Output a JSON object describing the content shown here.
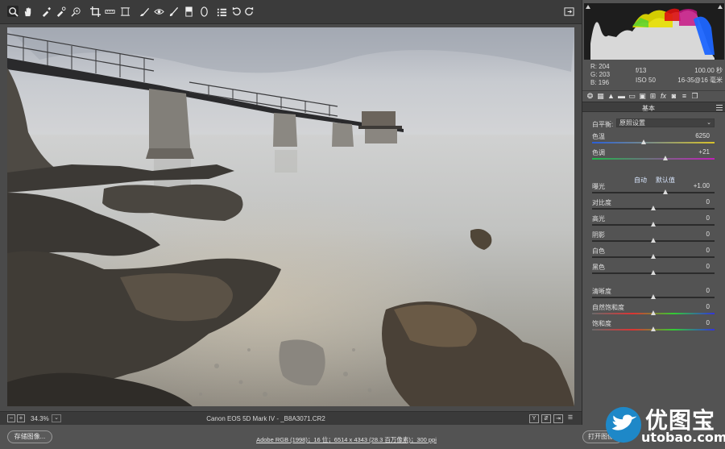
{
  "toolbar": {
    "tools": [
      {
        "name": "zoom-tool",
        "icon": "magnifier-icon"
      },
      {
        "name": "hand-tool",
        "icon": "hand-icon"
      },
      {
        "name": "white-balance-tool",
        "icon": "eyedropper-icon"
      },
      {
        "name": "color-sampler-tool",
        "icon": "color-sampler-icon"
      },
      {
        "name": "targeted-adjustment-tool",
        "icon": "target-icon"
      },
      {
        "name": "crop-tool",
        "icon": "crop-icon"
      },
      {
        "name": "straighten-tool",
        "icon": "ruler-icon"
      },
      {
        "name": "transform-tool",
        "icon": "transform-icon"
      },
      {
        "name": "spot-removal-tool",
        "icon": "brush-heal-icon"
      },
      {
        "name": "red-eye-tool",
        "icon": "red-eye-icon"
      },
      {
        "name": "adjustment-brush-tool",
        "icon": "brush-icon"
      },
      {
        "name": "graduated-filter-tool",
        "icon": "gradient-icon"
      },
      {
        "name": "radial-filter-tool",
        "icon": "ellipse-icon"
      },
      {
        "name": "preferences-button",
        "icon": "list-icon"
      },
      {
        "name": "rotate-left-button",
        "icon": "rotate-ccw-icon"
      },
      {
        "name": "rotate-right-button",
        "icon": "rotate-cw-icon"
      }
    ]
  },
  "readout": {
    "r": "R: 204",
    "g": "G: 203",
    "b": "B: 196",
    "aperture": "f/13",
    "shutter": "100.00 秒",
    "iso": "ISO 50",
    "lens": "16-35@16 毫米"
  },
  "panel": {
    "section_title": "基本",
    "wb_label": "白平衡:",
    "wb_value": "原照设置",
    "auto_label": "自动",
    "default_label": "默认值",
    "sliders": [
      {
        "id": "temperature",
        "label": "色温",
        "value": "6250",
        "pos": 0.42
      },
      {
        "id": "tint",
        "label": "色调",
        "value": "+21",
        "pos": 0.6
      },
      {
        "id": "exposure",
        "label": "曝光",
        "value": "+1.00",
        "pos": 0.6
      },
      {
        "id": "contrast",
        "label": "对比度",
        "value": "0",
        "pos": 0.5
      },
      {
        "id": "highlights",
        "label": "高光",
        "value": "0",
        "pos": 0.5
      },
      {
        "id": "shadows",
        "label": "阴影",
        "value": "0",
        "pos": 0.5
      },
      {
        "id": "whites",
        "label": "白色",
        "value": "0",
        "pos": 0.5
      },
      {
        "id": "blacks",
        "label": "黑色",
        "value": "0",
        "pos": 0.5
      },
      {
        "id": "clarity",
        "label": "清晰度",
        "value": "0",
        "pos": 0.5
      },
      {
        "id": "vibrance",
        "label": "自然饱和度",
        "value": "0",
        "pos": 0.5
      },
      {
        "id": "saturation",
        "label": "饱和度",
        "value": "0",
        "pos": 0.5
      }
    ]
  },
  "status": {
    "zoom": "34.3%",
    "file": "Canon EOS 5D Mark IV - _B8A3071.CR2",
    "view_y": "Y"
  },
  "bottom": {
    "save_label": "存储图像...",
    "workflow_link": "Adobe RGB (1998)；16 位；6514 x 4343 (28.3 百万像素)；300 ppi",
    "open_label": "打开图像"
  },
  "watermark": {
    "title": "优图宝",
    "url": "utobao.com"
  },
  "colors": {
    "panel_bg": "#535353",
    "toolbar_bg": "#3b3b3b",
    "histogram_bg": "#1d1d1d",
    "link": "#d9e7ff"
  }
}
